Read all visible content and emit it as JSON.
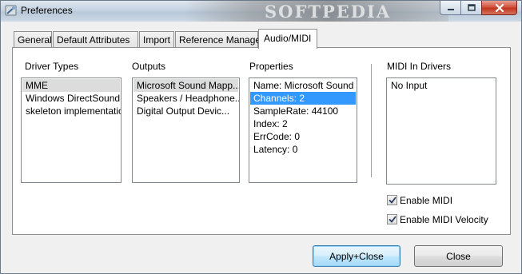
{
  "window": {
    "title": "Preferences",
    "watermark_text": "SOFTPEDIA",
    "close_color": "#c2361f"
  },
  "tabs": [
    {
      "label": "General",
      "active": false
    },
    {
      "label": "Default Attributes",
      "active": false
    },
    {
      "label": "Import",
      "active": false
    },
    {
      "label": "Reference Manager",
      "active": false
    },
    {
      "label": "Audio/MIDI",
      "active": true
    }
  ],
  "driver_types": {
    "heading": "Driver Types",
    "items": [
      "MME",
      "Windows DirectSound",
      "skeleton implementation"
    ],
    "selected_index": 0
  },
  "outputs": {
    "heading": "Outputs",
    "items": [
      "Microsoft Sound Mapp...",
      "Speakers / Headphone...",
      "Digital Output Devic..."
    ],
    "selected_index": 0
  },
  "properties": {
    "heading": "Properties",
    "items": [
      "Name: Microsoft Sound ...",
      "Channels: 2",
      "SampleRate: 44100",
      "Index: 2",
      "ErrCode: 0",
      "Latency: 0"
    ],
    "selected_index": 1
  },
  "midi_in_drivers": {
    "heading": "MIDI In Drivers",
    "items": [
      "No Input"
    ]
  },
  "options": {
    "enable_midi": {
      "label": "Enable MIDI",
      "checked": true
    },
    "enable_midi_velocity": {
      "label": "Enable MIDI Velocity",
      "checked": true
    }
  },
  "buttons": {
    "apply_close": "Apply+Close",
    "close": "Close"
  },
  "colors": {
    "selection_blue": "#3399ff",
    "selection_gray": "#dcdcdc",
    "default_button_border": "#3c7fb1"
  }
}
